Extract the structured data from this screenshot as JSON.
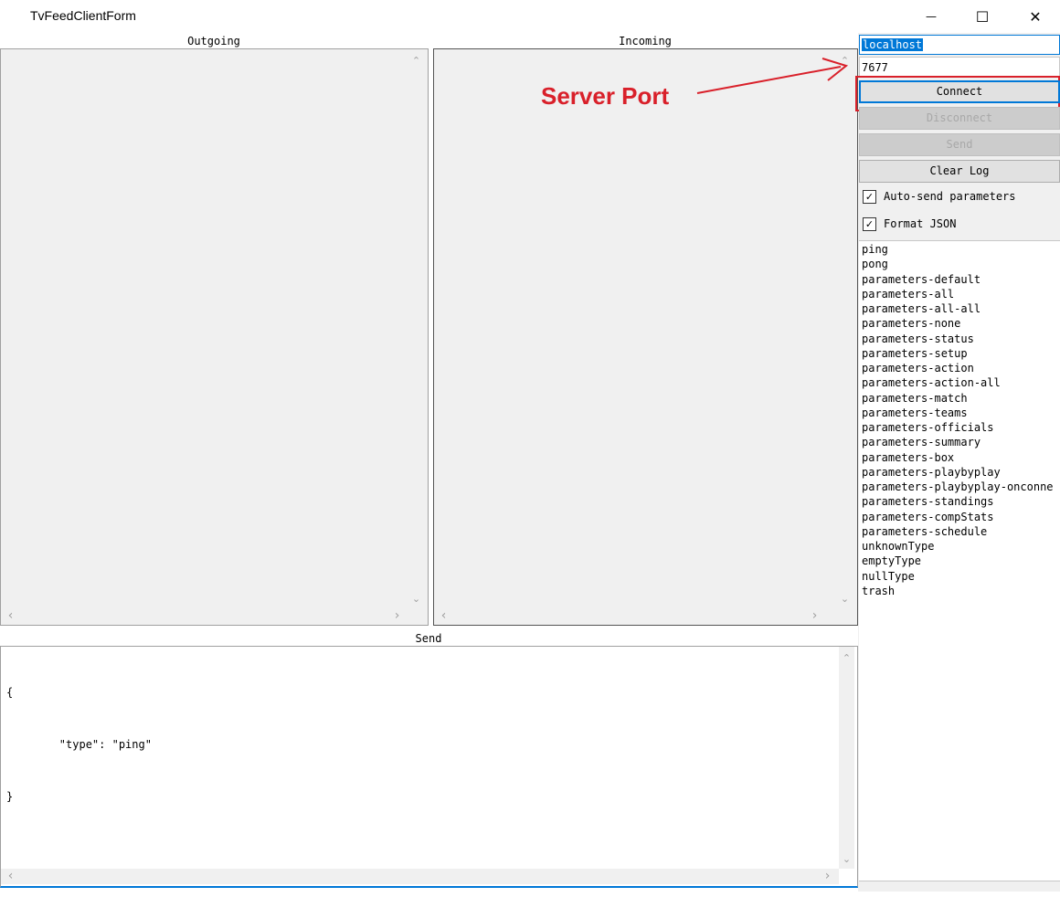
{
  "window": {
    "title": "TvFeedClientForm",
    "minimize_glyph": "—",
    "maximize_glyph": "☐",
    "close_glyph": "✕"
  },
  "outgoing": {
    "label": "Outgoing"
  },
  "incoming": {
    "label": "Incoming"
  },
  "send": {
    "label": "Send",
    "lines": [
      "{",
      "        \"type\": \"ping\"",
      "}"
    ]
  },
  "connection": {
    "host": "localhost",
    "port": "7677"
  },
  "buttons": {
    "connect": "Connect",
    "disconnect": "Disconnect",
    "send": "Send",
    "clear_log": "Clear Log"
  },
  "options": {
    "auto_send": {
      "label": "Auto-send parameters",
      "checked": true
    },
    "format_json": {
      "label": "Format JSON",
      "checked": true
    }
  },
  "message_types": [
    "ping",
    "pong",
    "parameters-default",
    "parameters-all",
    "parameters-all-all",
    "parameters-none",
    "parameters-status",
    "parameters-setup",
    "parameters-action",
    "parameters-action-all",
    "parameters-match",
    "parameters-teams",
    "parameters-officials",
    "parameters-summary",
    "parameters-box",
    "parameters-playbyplay",
    "parameters-playbyplay-onconne",
    "parameters-standings",
    "parameters-compStats",
    "parameters-schedule",
    "unknownType",
    "emptyType",
    "nullType",
    "trash"
  ],
  "annotation": {
    "text": "Server Port",
    "color": "#d9202a"
  },
  "glyphs": {
    "up": "⌃",
    "down": "⌄",
    "left": "‹",
    "right": "›",
    "check": "✓"
  }
}
